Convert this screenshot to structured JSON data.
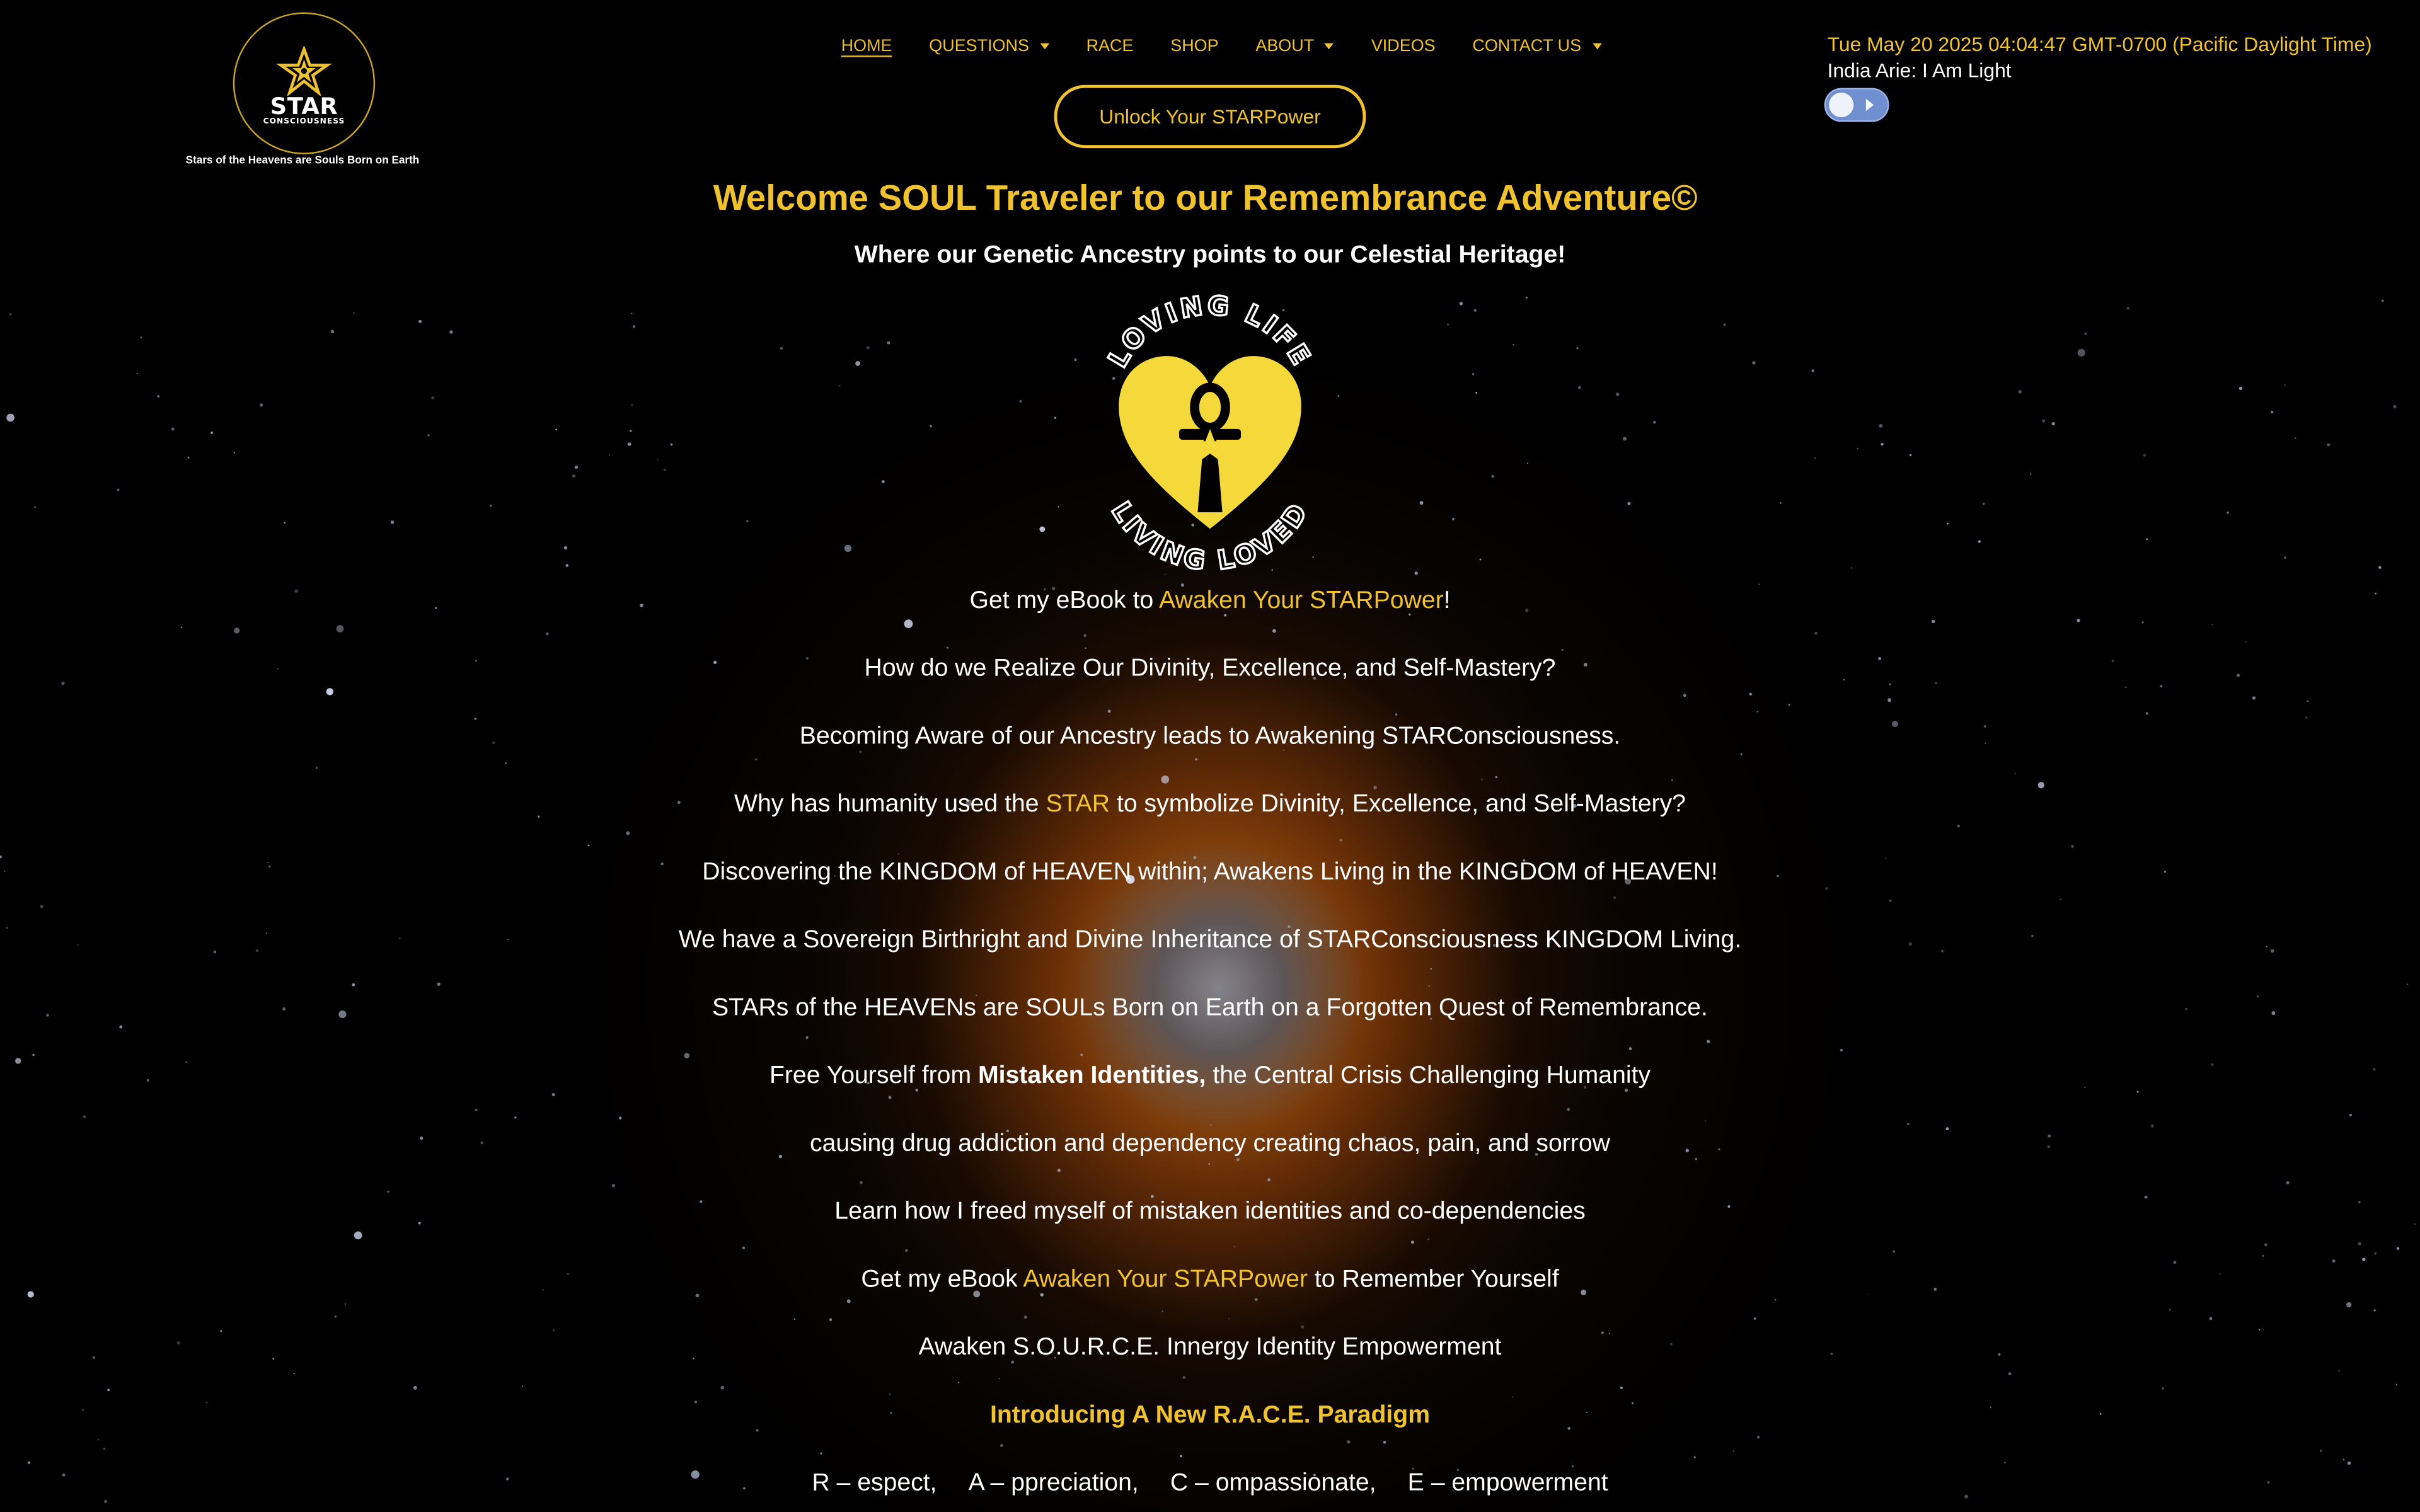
{
  "logo": {
    "word": "STAR",
    "sub": "CONSCIOUSNESS",
    "tagline": "Stars of the Heavens are Souls Born on Earth"
  },
  "nav": {
    "items": [
      {
        "label": "HOME",
        "active": true,
        "dropdown": false
      },
      {
        "label": "QUESTIONS",
        "active": false,
        "dropdown": true
      },
      {
        "label": "RACE",
        "active": false,
        "dropdown": false
      },
      {
        "label": "SHOP",
        "active": false,
        "dropdown": false
      },
      {
        "label": "ABOUT",
        "active": false,
        "dropdown": true
      },
      {
        "label": "VIDEOS",
        "active": false,
        "dropdown": false
      },
      {
        "label": "CONTACT US",
        "active": false,
        "dropdown": true
      }
    ],
    "cta_label": "Unlock Your STARPower"
  },
  "player": {
    "datetime": "Tue May 20 2025 04:04:47 GMT-0700 (Pacific Daylight Time)",
    "track": "India Arie: I Am Light",
    "toggle_on": false
  },
  "hero": {
    "title": "Welcome SOUL Traveler to our Remembrance Adventure©",
    "subtitle": "Where our Genetic Ancestry points to our Celestial Heritage!",
    "emblem_top": "LOVING LIFE",
    "emblem_bottom": "LIVING LOVED"
  },
  "content": {
    "l1_pre": "Get my eBook to ",
    "l1_link": "Awaken Your STARPower",
    "l1_post": "!",
    "l2": "How do we Realize Our Divinity, Excellence, and Self-Mastery?",
    "l3": "Becoming Aware of our Ancestry leads to Awakening STARConsciousness.",
    "l4_pre": "Why has humanity used the ",
    "l4_link": "STAR",
    "l4_post": " to symbolize Divinity, Excellence, and Self-Mastery?",
    "l5": "Discovering the KINGDOM of HEAVEN within; Awakens Living in the KINGDOM of HEAVEN!",
    "l6": "We have a Sovereign Birthright and Divine Inheritance of STARConsciousness KINGDOM Living.",
    "l7": "STARs of the HEAVENs are SOULs Born on Earth on a Forgotten Quest of Remembrance.",
    "l8_pre": "Free Yourself from ",
    "l8_bold": "Mistaken Identities,",
    "l8_post": " the Central Crisis Challenging Humanity",
    "l9": "causing drug addiction and dependency creating chaos, pain, and sorrow",
    "l10": "Learn how I freed myself of mistaken identities and co-dependencies",
    "l11_pre": "Get my eBook ",
    "l11_link": "Awaken Your STARPower",
    "l11_post": " to Remember Yourself",
    "l12": "Awaken S.O.U.R.C.E. Innergy Identity Empowerment",
    "l13": "Introducing A New R.A.C.E. Paradigm",
    "race": [
      "R – espect,",
      "A – ppreciation,",
      "C – ompassionate,",
      "E – empowerment"
    ]
  },
  "colors": {
    "accent": "#f0c22e",
    "toggle": "#6f8fd0",
    "background": "#000000",
    "nebula": "#d9781a"
  }
}
